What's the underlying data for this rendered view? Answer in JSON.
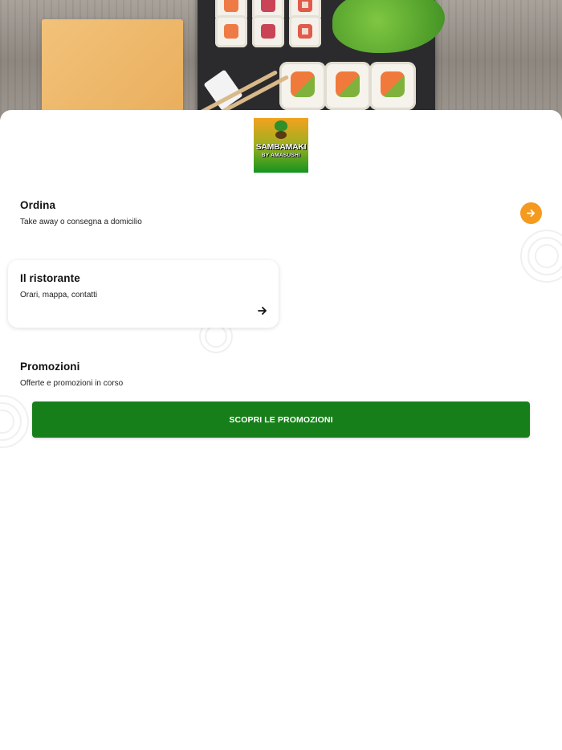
{
  "restaurant": {
    "logo_line1": "SAMBAMAKI",
    "logo_line2": "BY AMASUSHI"
  },
  "sections": {
    "order": {
      "title": "Ordina",
      "subtitle": "Take away o consegna a domicilio",
      "action_icon": "arrow-right-icon"
    },
    "restaurant": {
      "title": "Il ristorante",
      "subtitle": "Orari, mappa, contatti",
      "action_icon": "arrow-right-icon"
    },
    "promotions": {
      "title": "Promozioni",
      "subtitle": "Offerte e promozioni in corso",
      "button_label": "SCOPRI LE PROMOZIONI"
    }
  },
  "colors": {
    "accent_orange": "#f59a1f",
    "brand_green": "#177f1a",
    "background": "#ffffff"
  }
}
